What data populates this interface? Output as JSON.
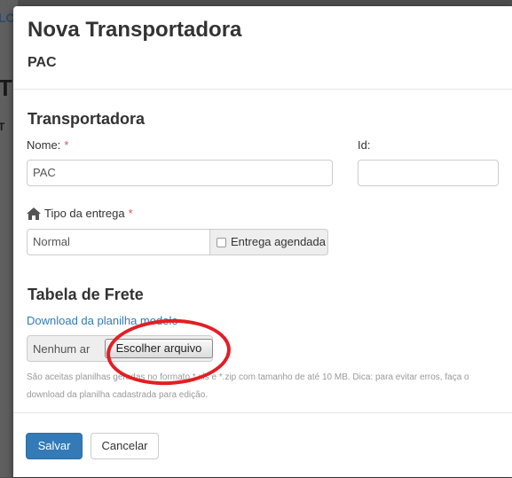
{
  "background": {
    "text_1": "LC",
    "text_2": "T",
    "text_3": "T"
  },
  "modal": {
    "title": "Nova Transportadora",
    "subtitle": "PAC"
  },
  "section_transportadora": {
    "title": "Transportadora",
    "name_label": "Nome:",
    "name_required": "*",
    "name_value": "PAC",
    "id_label": "Id:",
    "id_value": "",
    "delivery_label": "Tipo da entrega",
    "delivery_required": "*",
    "delivery_value": "Normal",
    "scheduled_label": "Entrega agendada",
    "scheduled_checked": false,
    "home_icon": "home-icon"
  },
  "section_frete": {
    "title": "Tabela de Frete",
    "download_link": "Download da planilha modelo",
    "file_status": "Nenhum arquivo selecionado",
    "file_status_visible": "Nenhum ar",
    "file_button": "Escolher arquivo",
    "help_text": "São aceitas planilhas geradas no formato *.xls e *.zip com tamanho de até 10 MB. Dica: para evitar erros, faça o download da planilha cadastrada para edição."
  },
  "footer": {
    "save_label": "Salvar",
    "cancel_label": "Cancelar"
  },
  "colors": {
    "primary": "#337ab7",
    "required": "#d9534f",
    "annotation": "#e31e24"
  }
}
